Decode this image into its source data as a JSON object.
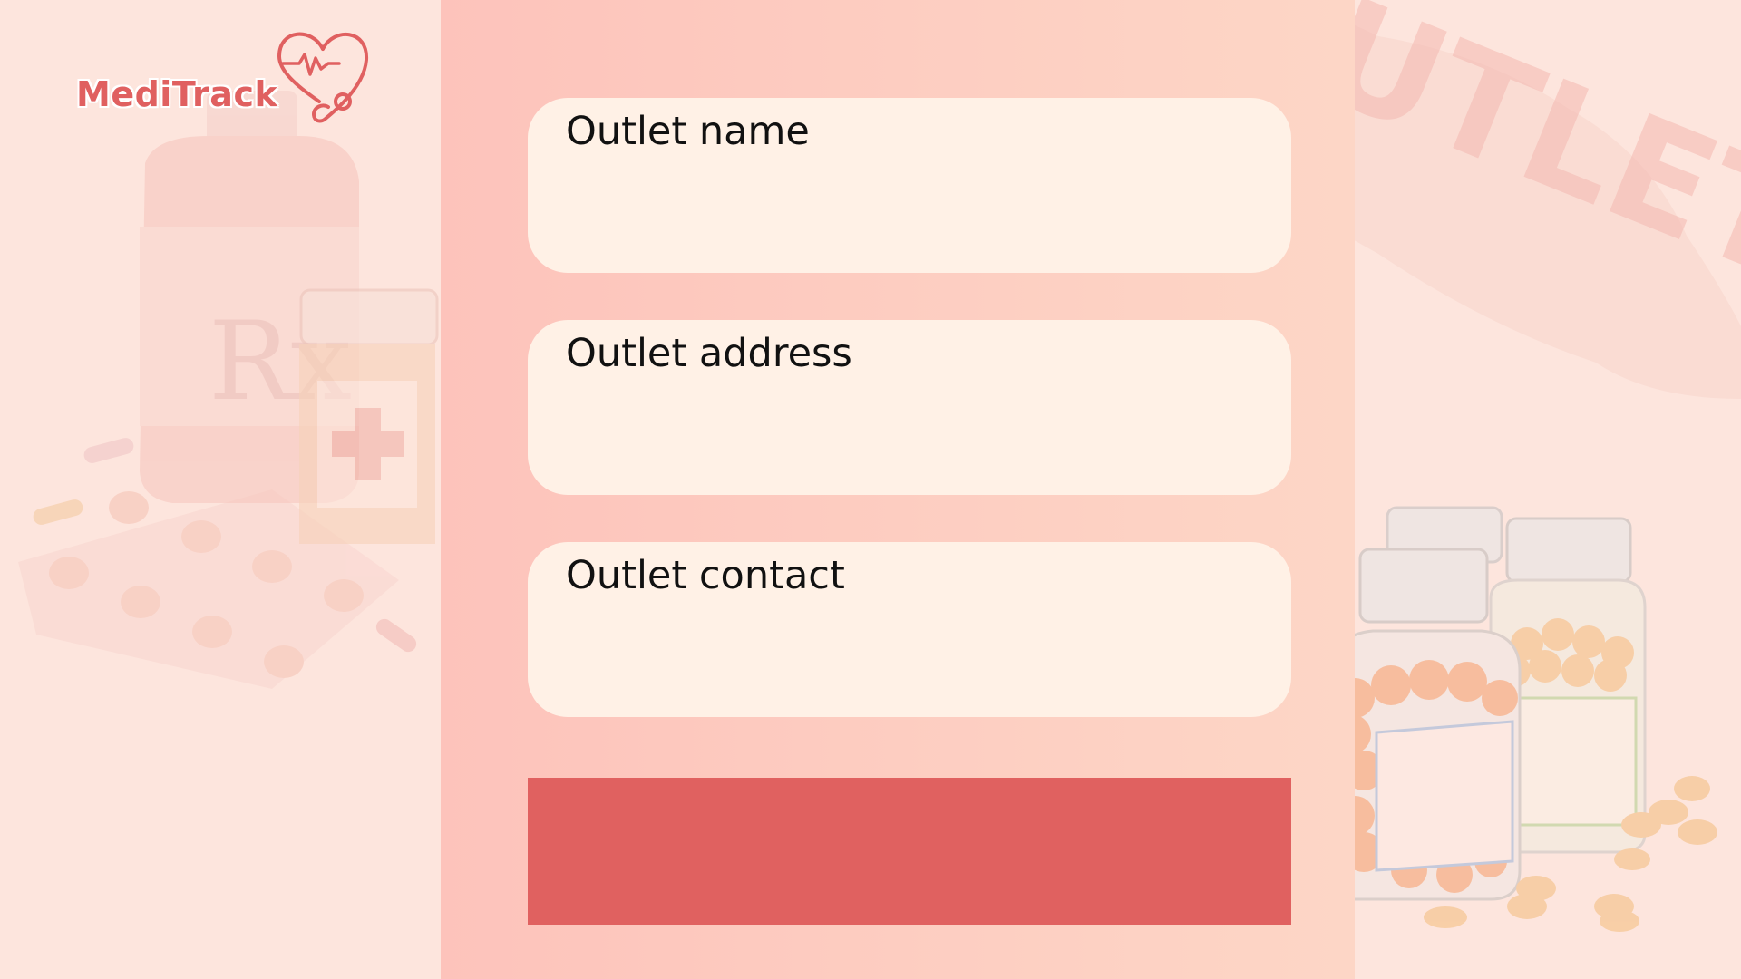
{
  "app": {
    "brand_name": "MediTrack",
    "logo_icon": "heart-stethoscope-icon"
  },
  "form": {
    "fields": [
      {
        "label": "Outlet name",
        "value": ""
      },
      {
        "label": "Outlet address",
        "value": ""
      },
      {
        "label": "Outlet contact",
        "value": ""
      }
    ],
    "submit_label": ""
  },
  "background": {
    "watermark_text": "OUTLET",
    "decor_icons": [
      "prescription-bottle-icon",
      "medicine-bottle-icon",
      "pill-blister-icon",
      "pill-jar-icon"
    ]
  },
  "colors": {
    "page_bg": "#fde5dd",
    "panel_bg": "#fdcdc1",
    "field_bg": "#fff1e6",
    "accent": "#e06160"
  }
}
